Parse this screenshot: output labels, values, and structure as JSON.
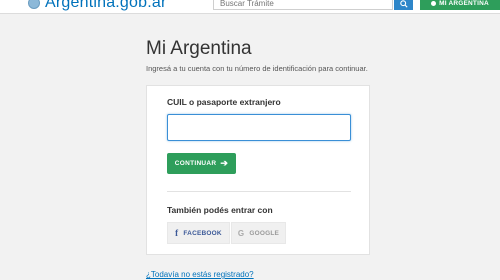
{
  "header": {
    "brand": "Argentina.gob.ar",
    "search_placeholder": "Buscar Trámite",
    "mi_argentina_label": "MI ARGENTINA"
  },
  "login": {
    "title": "Mi Argentina",
    "subtitle": "Ingresá a tu cuenta con tu número de identificación para continuar.",
    "field_label": "CUIL o pasaporte extranjero",
    "field_value": "",
    "continue_label": "CONTINUAR",
    "alt_label": "También podés entrar con",
    "facebook_label": "FACEBOOK",
    "google_label": "GOOGLE",
    "register_link": "¿Todavía no estás registrado?"
  },
  "colors": {
    "brand_blue": "#0072bb",
    "green": "#2e9e5b",
    "facebook": "#3b5998"
  }
}
